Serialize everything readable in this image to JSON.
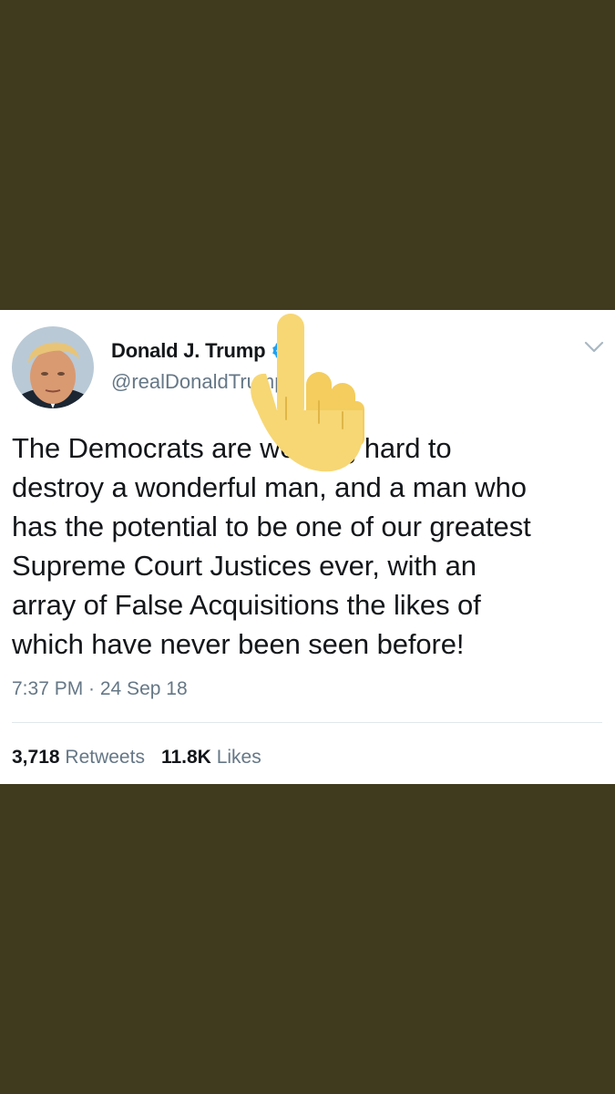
{
  "tweet": {
    "display_name": "Donald J. Trump",
    "handle": "@realDonaldTrump",
    "verified": true,
    "text": "The Democrats are working hard to\ndestroy a wonderful man, and a man who\nhas the potential to be one of our greatest\nSupreme Court Justices ever, with an\narray of False Acquisitions the likes of\nwhich have never been seen before!",
    "timestamp": "7:37 PM · 24 Sep 18",
    "retweets_count": "3,718",
    "retweets_label": "Retweets",
    "likes_count": "11.8K",
    "likes_label": "Likes"
  },
  "icons": {
    "verified": "verified-badge-icon",
    "menu": "chevron-down-icon",
    "overlay": "pointing-hand-emoji"
  },
  "colors": {
    "background": "#403a1e",
    "card": "#ffffff",
    "verified_blue": "#1da1f2",
    "muted_text": "#657786",
    "hand": "#f7d774"
  }
}
